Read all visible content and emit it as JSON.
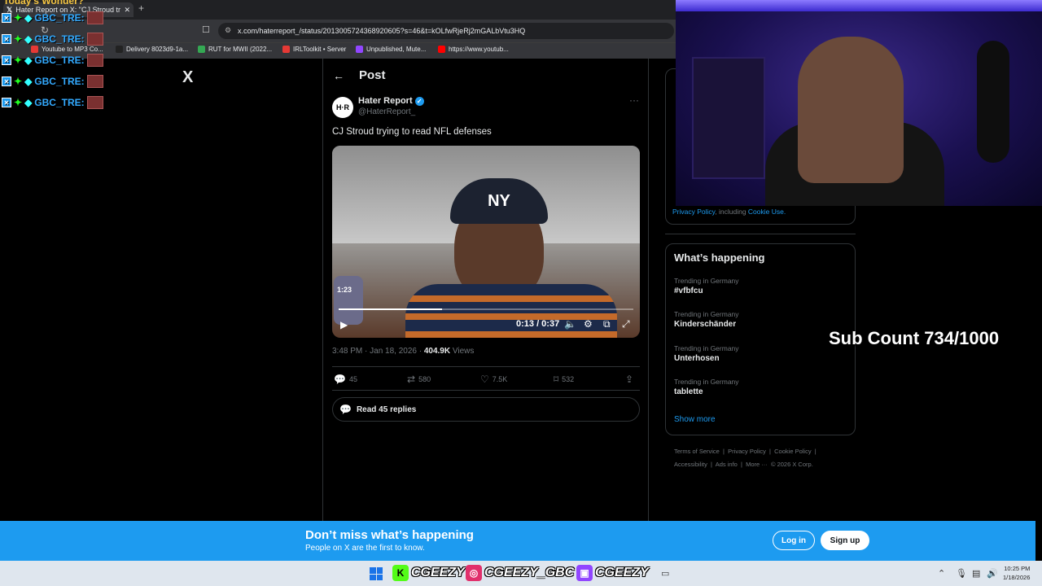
{
  "browser": {
    "tab_title": "Hater Report on X: \"CJ Stroud tr",
    "url": "x.com/haterreport_/status/2013005724368920605?s=46&t=kOLfwRjeRj2mGALbVtu3HQ",
    "bookmarks": [
      {
        "label": "Youtube to MP3 Co...",
        "color": "#e53935"
      },
      {
        "label": "Delivery 8023d9-1a...",
        "color": "#222222"
      },
      {
        "label": "RUT for MWII (2022...",
        "color": "#34a853"
      },
      {
        "label": "IRLToolkit • Server",
        "color": "#e53935"
      },
      {
        "label": "Unpublished, Mute...",
        "color": "#9146ff"
      },
      {
        "label": "https://www.youtub...",
        "color": "#ff0000"
      }
    ]
  },
  "overlay": {
    "top_title": "Today's Wonder?",
    "chat": [
      {
        "name": "GBC_TRE:"
      },
      {
        "name": "GBC_TRE:"
      },
      {
        "name": "GBC_TRE:"
      },
      {
        "name": "GBC_TRE:"
      },
      {
        "name": "GBC_TRE:"
      }
    ],
    "sub_count": "Sub Count 734/1000"
  },
  "x": {
    "logo": "X",
    "header_title": "Post",
    "author_name": "Hater Report",
    "author_handle": "@HaterReport_",
    "avatar_text": "H·R",
    "tweet_text": "CJ Stroud trying to read NFL defenses",
    "video": {
      "cap_logo": "NY",
      "phone_time": "1:23",
      "time": "0:13 / 0:37",
      "progress": 0.35
    },
    "meta": {
      "time": "3:48 PM · Jan 18, 2026 · ",
      "views_count": "404.9K",
      "views_label": " Views"
    },
    "actions": {
      "replies": "45",
      "reposts": "580",
      "likes": "7.5K",
      "bookmarks": "532"
    },
    "read_replies": "Read 45 replies",
    "policy": {
      "link1": "Privacy Policy",
      "mid": ", including ",
      "link2": "Cookie Use."
    },
    "trends_title": "What’s happening",
    "trends": [
      {
        "context": "Trending in Germany",
        "name": "#vfbfcu"
      },
      {
        "context": "Trending in Germany",
        "name": "Kinderschänder"
      },
      {
        "context": "Trending in Germany",
        "name": "Unterhosen"
      },
      {
        "context": "Trending in Germany",
        "name": "tablette"
      }
    ],
    "show_more": "Show more",
    "footer": {
      "terms": "Terms of Service",
      "privacy": "Privacy Policy",
      "cookie": "Cookie Policy",
      "accessibility": "Accessibility",
      "ads": "Ads info",
      "more": "More ···",
      "copyright": "© 2026 X Corp."
    },
    "banner": {
      "title": "Don’t miss what’s happening",
      "subtitle": "People on X are the first to know.",
      "login": "Log in",
      "signup": "Sign up"
    }
  },
  "taskbar": {
    "kick": "CGEEZY",
    "instagram": "CGEEZY_GBC",
    "twitch": "CGEEZY",
    "time": "10:25 PM",
    "date": "1/18/2026"
  },
  "colors": {
    "accent": "#1d9bf0",
    "kick": "#53fc18",
    "instagram": "#e1306c",
    "twitch": "#9146ff"
  }
}
